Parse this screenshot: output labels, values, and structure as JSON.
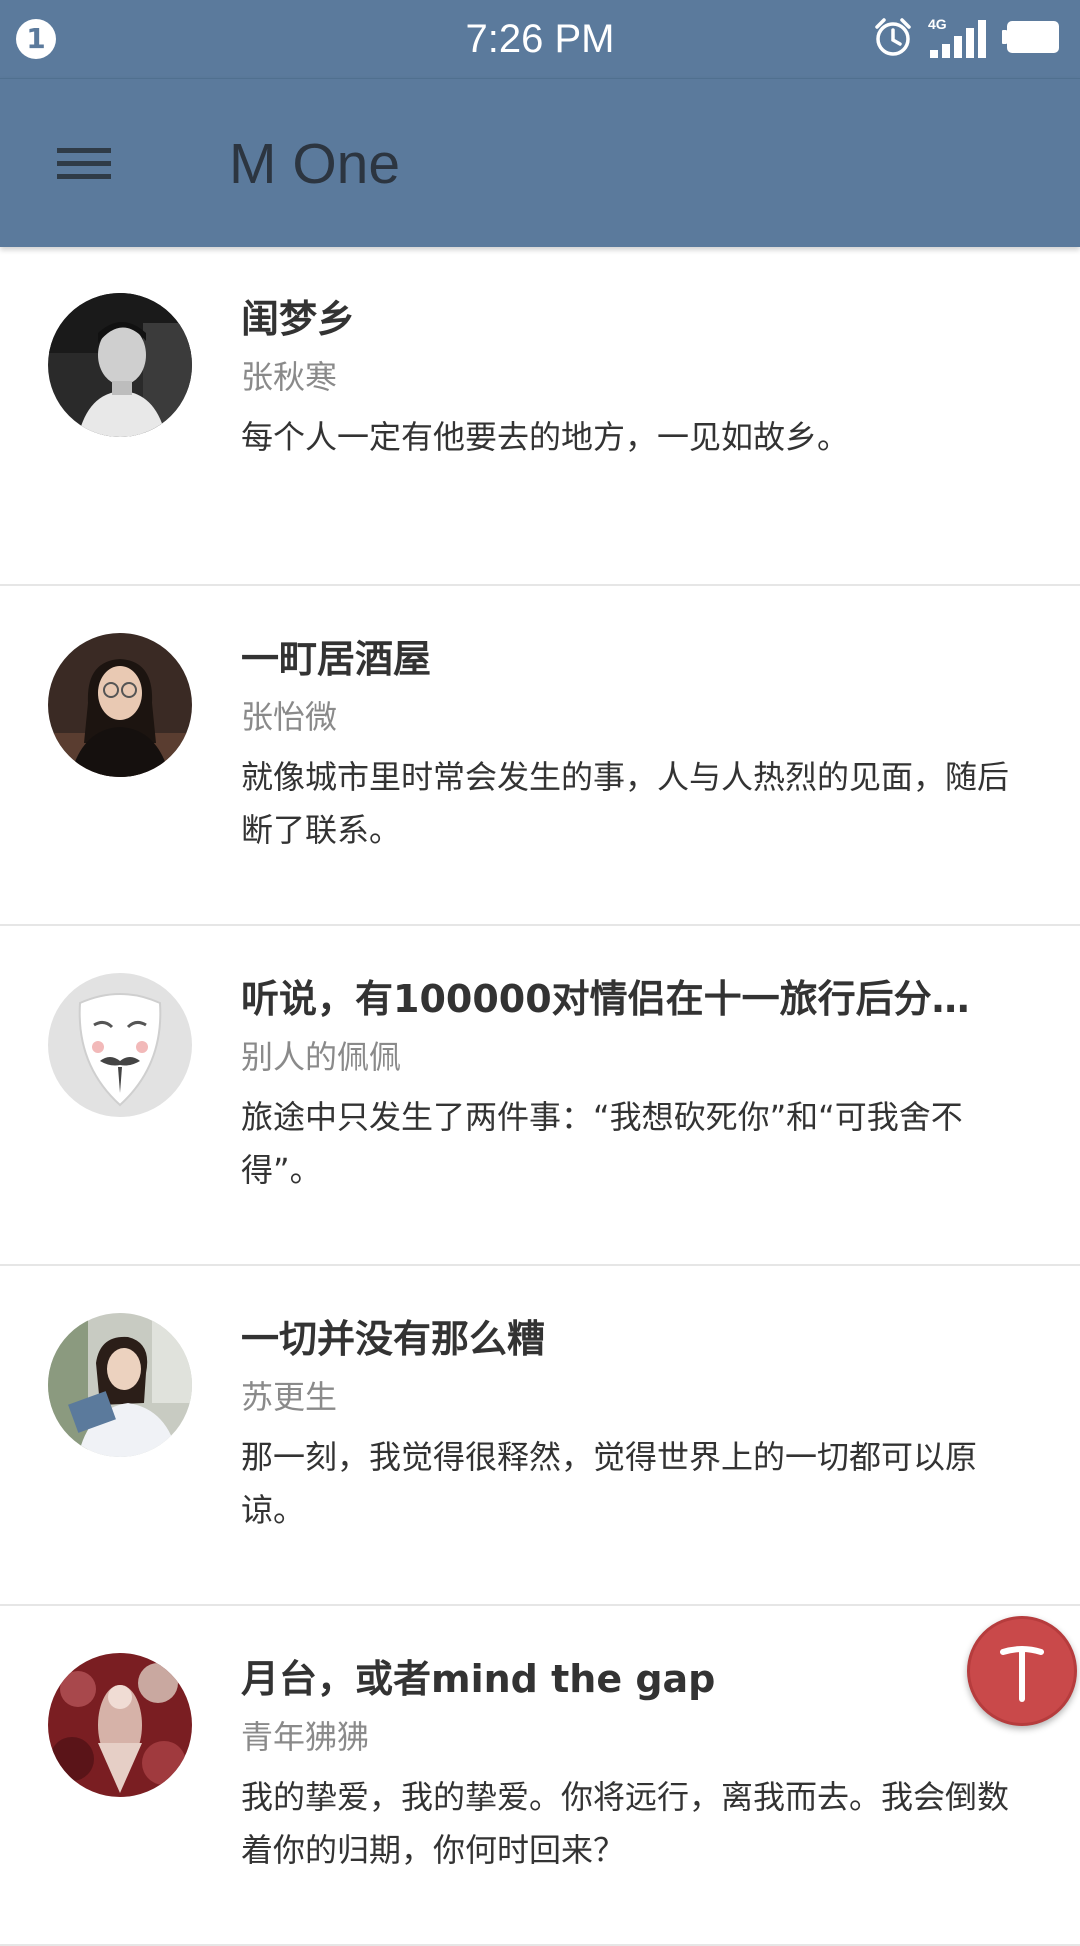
{
  "status_bar": {
    "notification_count": "1",
    "time": "7:26 PM",
    "network": "4G",
    "icons": [
      "alarm-icon",
      "signal-icon",
      "battery-icon"
    ]
  },
  "app_bar": {
    "title": "M One",
    "menu_icon": "hamburger-menu-icon",
    "color": "#5b7a9c"
  },
  "articles": [
    {
      "title": "闺梦乡",
      "author": "张秋寒",
      "excerpt": "每个人一定有他要去的地方，一见如故乡。",
      "avatar": "man-portrait-bw"
    },
    {
      "title": "一町居酒屋",
      "author": "张怡微",
      "excerpt": "就像城市里时常会发生的事，人与人热烈的见面，随后断了联系。",
      "avatar": "woman-with-glasses"
    },
    {
      "title": "听说，有100000对情侣在十一旅行后分…",
      "author": "别人的佩佩",
      "excerpt": "旅途中只发生了两件事：“我想砍死你”和“可我舍不得”。",
      "avatar": "guy-fawkes-mask"
    },
    {
      "title": "一切并没有那么糟",
      "author": "苏更生",
      "excerpt": "那一刻，我觉得很释然，觉得世界上的一切都可以原谅。",
      "avatar": "woman-reading"
    },
    {
      "title": "月台，或者mind the gap",
      "author": "青年狒狒",
      "excerpt": "我的挚爱，我的挚爱。你将远行，离我而去。我会倒数着你的归期，你何时回来？",
      "avatar": "red-collage"
    }
  ],
  "fab": {
    "icon": "text-t-icon",
    "color": "#c9494a"
  }
}
